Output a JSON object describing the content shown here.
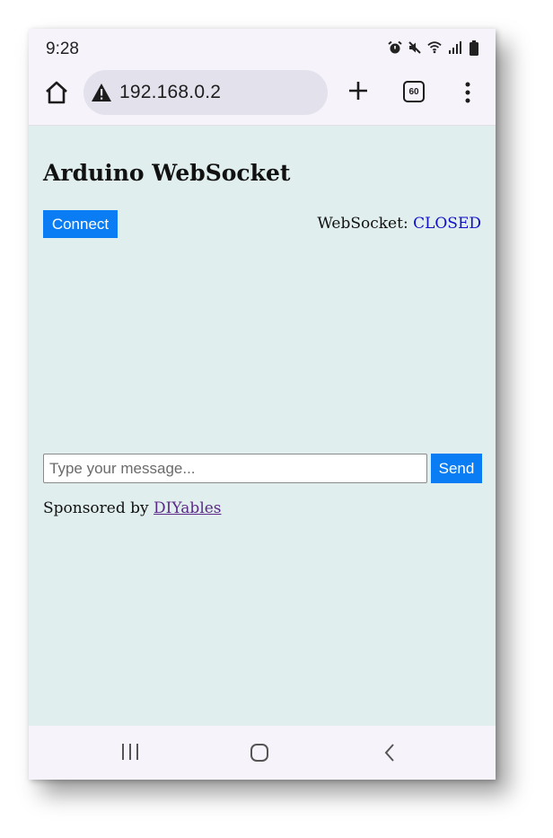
{
  "status_bar": {
    "time": "9:28",
    "icons": [
      "alarm-icon",
      "mute-icon",
      "wifi-icon",
      "signal-icon",
      "battery-icon"
    ]
  },
  "browser": {
    "url": "192.168.0.2",
    "tab_count": "60",
    "security": "warning-icon"
  },
  "page": {
    "title": "Arduino WebSocket",
    "connect_label": "Connect",
    "ws_label": "WebSocket: ",
    "ws_state": "CLOSED",
    "message_placeholder": "Type your message...",
    "message_value": "",
    "send_label": "Send",
    "sponsor_prefix": "Sponsored by ",
    "sponsor_link": "DIYables"
  },
  "colors": {
    "accent": "#0a7df4",
    "page_background": "#e0eeed",
    "ws_state": "#1010c8",
    "link": "#5b2a86"
  },
  "nav": {
    "icons": [
      "recent-apps-icon",
      "home-circle-icon",
      "back-icon"
    ]
  }
}
